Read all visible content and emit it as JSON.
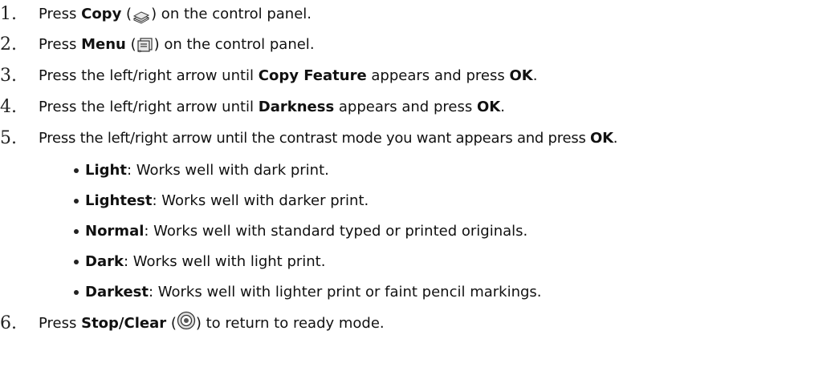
{
  "steps": [
    {
      "num": "1.",
      "pre": "Press ",
      "bold": "Copy",
      "paren_open": " (",
      "paren_close": ") on the control panel.",
      "icon": "copy-icon"
    },
    {
      "num": "2.",
      "pre": "Press ",
      "bold": "Menu",
      "paren_open": " (",
      "paren_close": ") on the control panel.",
      "icon": "menu-icon"
    },
    {
      "num": "3.",
      "pre": "Press the left/right arrow until ",
      "bold": "Copy Feature",
      "mid": " appears and press ",
      "bold2": "OK",
      "post": "."
    },
    {
      "num": "4.",
      "pre": "Press the left/right arrow until ",
      "bold": "Darkness",
      "mid": " appears and press ",
      "bold2": "OK",
      "post": "."
    },
    {
      "num": "5.",
      "pre": "Press the left/right arrow until the contrast mode you want appears and press ",
      "bold": "OK",
      "post": "."
    },
    {
      "num": "6.",
      "pre": "Press ",
      "bold": "Stop/Clear",
      "paren_open": " (",
      "paren_close": ") to return to ready mode.",
      "icon": "stop-clear-icon"
    }
  ],
  "modes": [
    {
      "name": "Light",
      "desc": ": Works well with dark print."
    },
    {
      "name": "Lightest",
      "desc": ": Works well with darker print."
    },
    {
      "name": "Normal",
      "desc": ": Works well with standard typed or printed originals."
    },
    {
      "name": "Dark",
      "desc": ": Works well with light print."
    },
    {
      "name": "Darkest",
      "desc": ": Works well with lighter print or faint pencil markings."
    }
  ]
}
